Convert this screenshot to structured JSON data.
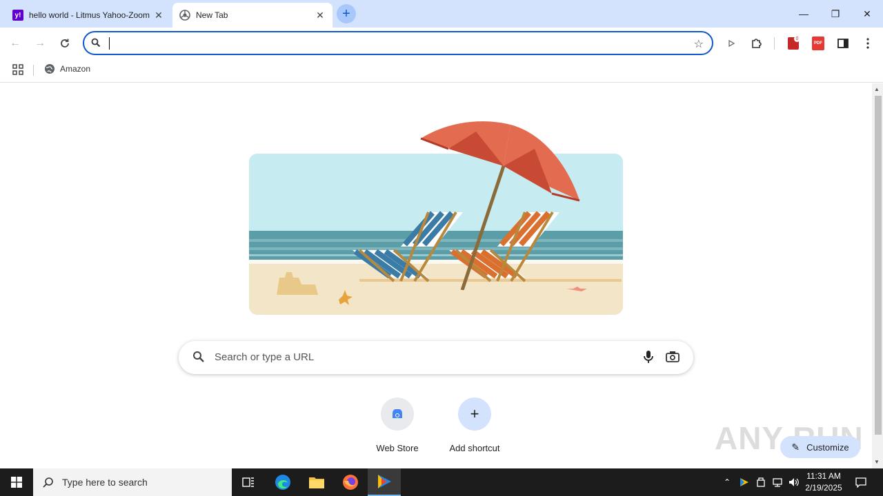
{
  "tabs": [
    {
      "title": "hello world - Litmus Yahoo-Zoom"
    },
    {
      "title": "New Tab"
    }
  ],
  "omnibox": {
    "value": ""
  },
  "bookmarks": [
    {
      "label": "Amazon"
    }
  ],
  "ntp": {
    "search_placeholder": "Search or type a URL",
    "shortcuts": [
      {
        "label": "Web Store"
      },
      {
        "label": "Add shortcut"
      }
    ],
    "customize_label": "Customize",
    "watermark": "ANY RUN"
  },
  "taskbar": {
    "search_placeholder": "Type here to search",
    "time": "11:31 AM",
    "date": "2/19/2025"
  },
  "colors": {
    "accent": "#0b57d0",
    "tabstrip": "#d3e3fd",
    "taskbar": "#1c1c1c"
  }
}
